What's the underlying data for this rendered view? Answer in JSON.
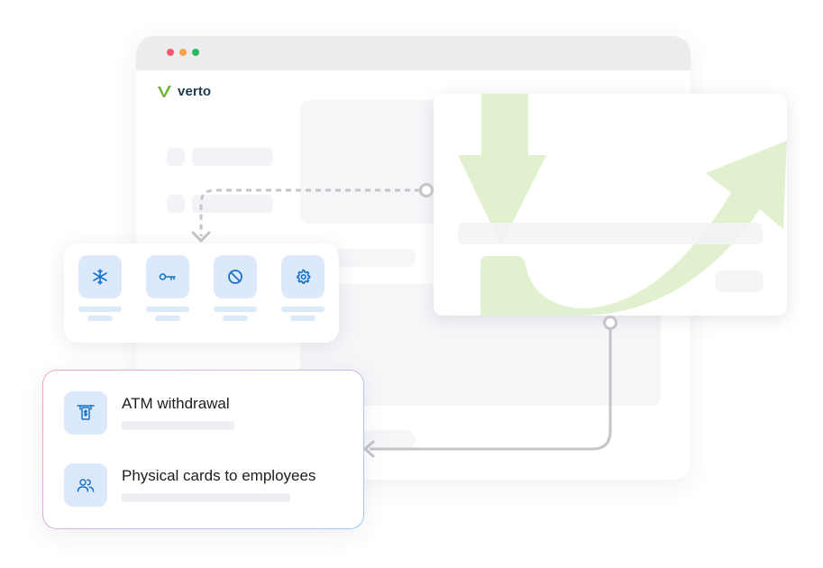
{
  "brand": {
    "name": "verto",
    "logo_color": "#6bb32e"
  },
  "window_controls": {
    "close_color": "#f0566d",
    "minimize_color": "#f6a24b",
    "maximize_color": "#2fb864"
  },
  "card_actions": [
    {
      "name": "freeze",
      "icon": "snowflake-icon"
    },
    {
      "name": "pin",
      "icon": "key-icon"
    },
    {
      "name": "block",
      "icon": "block-icon"
    },
    {
      "name": "settings",
      "icon": "gear-icon"
    }
  ],
  "features": [
    {
      "title": "ATM withdrawal",
      "icon": "atm-cash-icon"
    },
    {
      "title": "Physical cards to employees",
      "icon": "users-icon"
    }
  ],
  "colors": {
    "accent_blue": "#1a73c8",
    "icon_tile": "#dce9fb",
    "arrow_green": "#c8e6a8",
    "connector_gray": "#c4c5c8"
  }
}
